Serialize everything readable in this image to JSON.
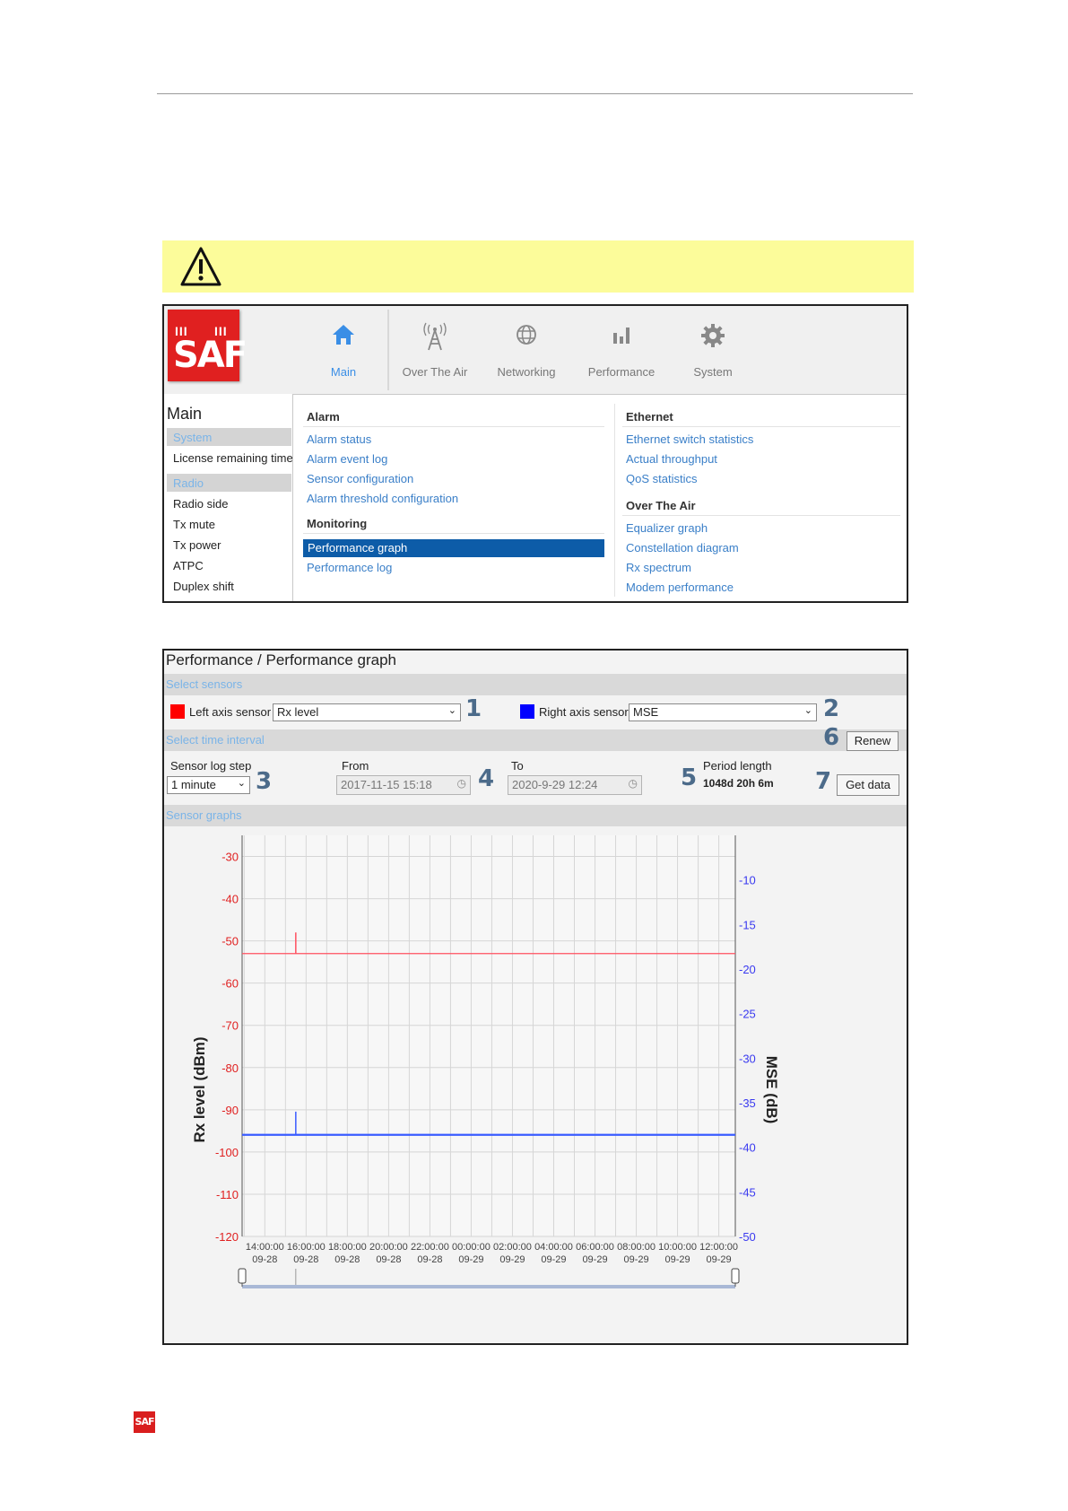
{
  "menu_screenshot": {
    "logo": "SAF",
    "nav": [
      {
        "label": "Main",
        "icon": "home-icon",
        "active": true
      },
      {
        "label": "Over The Air",
        "icon": "antenna-icon"
      },
      {
        "label": "Networking",
        "icon": "globe-icon"
      },
      {
        "label": "Performance",
        "icon": "bar-chart-icon"
      },
      {
        "label": "System",
        "icon": "gear-icon"
      }
    ],
    "sidebar": {
      "title": "Main",
      "sections": [
        {
          "label": "System",
          "items": [
            "License remaining time"
          ]
        },
        {
          "label": "Radio",
          "items": [
            "Radio side",
            "Tx mute",
            "Tx power",
            "ATPC",
            "Duplex shift"
          ]
        }
      ]
    },
    "menu": {
      "alarm": {
        "heading": "Alarm",
        "items": [
          "Alarm status",
          "Alarm event log",
          "Sensor configuration",
          "Alarm threshold configuration"
        ]
      },
      "monitoring": {
        "heading": "Monitoring",
        "selected": "Performance graph",
        "items": [
          "Performance log"
        ]
      },
      "ethernet": {
        "heading": "Ethernet",
        "items": [
          "Ethernet switch statistics",
          "Actual throughput",
          "QoS statistics"
        ]
      },
      "over_the_air": {
        "heading": "Over The Air",
        "items": [
          "Equalizer graph",
          "Constellation diagram",
          "Rx spectrum",
          "Modem performance"
        ]
      }
    }
  },
  "graph_screenshot": {
    "breadcrumb": "Performance / Performance graph",
    "select_sensors_label": "Select sensors",
    "left_sensor": {
      "label": "Left axis sensor",
      "value": "Rx level",
      "color": "#ff0000",
      "callout": "1"
    },
    "right_sensor": {
      "label": "Right axis sensor",
      "value": "MSE",
      "color": "#0000ff",
      "callout": "2"
    },
    "select_interval_label": "Select time interval",
    "renew": {
      "label": "Renew",
      "callout": "6"
    },
    "log_step": {
      "label": "Sensor log step",
      "value": "1 minute",
      "callout": "3"
    },
    "from": {
      "label": "From",
      "value": "2017-11-15 15:18"
    },
    "to": {
      "label": "To",
      "value": "2020-9-29 12:24"
    },
    "interval_callout": "4",
    "period": {
      "label": "Period length",
      "value": "1048d 20h 6m",
      "callout": "5"
    },
    "get_data": {
      "label": "Get data",
      "callout": "7"
    },
    "sensor_graphs_label": "Sensor graphs"
  },
  "chart_data": {
    "type": "line",
    "ylabel": "Rx level (dBm)",
    "y2label": "MSE (dB)",
    "ylim": [
      -120,
      -25
    ],
    "y_ticks": [
      -30,
      -40,
      -50,
      -60,
      -70,
      -80,
      -90,
      -100,
      -110,
      -120
    ],
    "y2lim": [
      -50,
      -5
    ],
    "y2_ticks": [
      -10,
      -15,
      -20,
      -25,
      -30,
      -35,
      -40,
      -45,
      -50
    ],
    "x_ticks": [
      {
        "time": "14:00:00",
        "date": "09-28"
      },
      {
        "time": "16:00:00",
        "date": "09-28"
      },
      {
        "time": "18:00:00",
        "date": "09-28"
      },
      {
        "time": "20:00:00",
        "date": "09-28"
      },
      {
        "time": "22:00:00",
        "date": "09-28"
      },
      {
        "time": "00:00:00",
        "date": "09-29"
      },
      {
        "time": "02:00:00",
        "date": "09-29"
      },
      {
        "time": "04:00:00",
        "date": "09-29"
      },
      {
        "time": "06:00:00",
        "date": "09-29"
      },
      {
        "time": "08:00:00",
        "date": "09-29"
      },
      {
        "time": "10:00:00",
        "date": "09-29"
      },
      {
        "time": "12:00:00",
        "date": "09-29"
      }
    ],
    "x_range_hours": [
      12.9,
      36.8
    ],
    "series": [
      {
        "name": "Rx level",
        "axis": "left",
        "color": "#ff5060",
        "value": -53,
        "spike": {
          "x_hours": 15.5,
          "value": -48
        }
      },
      {
        "name": "MSE",
        "axis": "right",
        "color": "#3a5cff",
        "value": -38.6,
        "spike": {
          "x_hours": 15.5,
          "value": -36
        }
      }
    ],
    "grid": true
  }
}
